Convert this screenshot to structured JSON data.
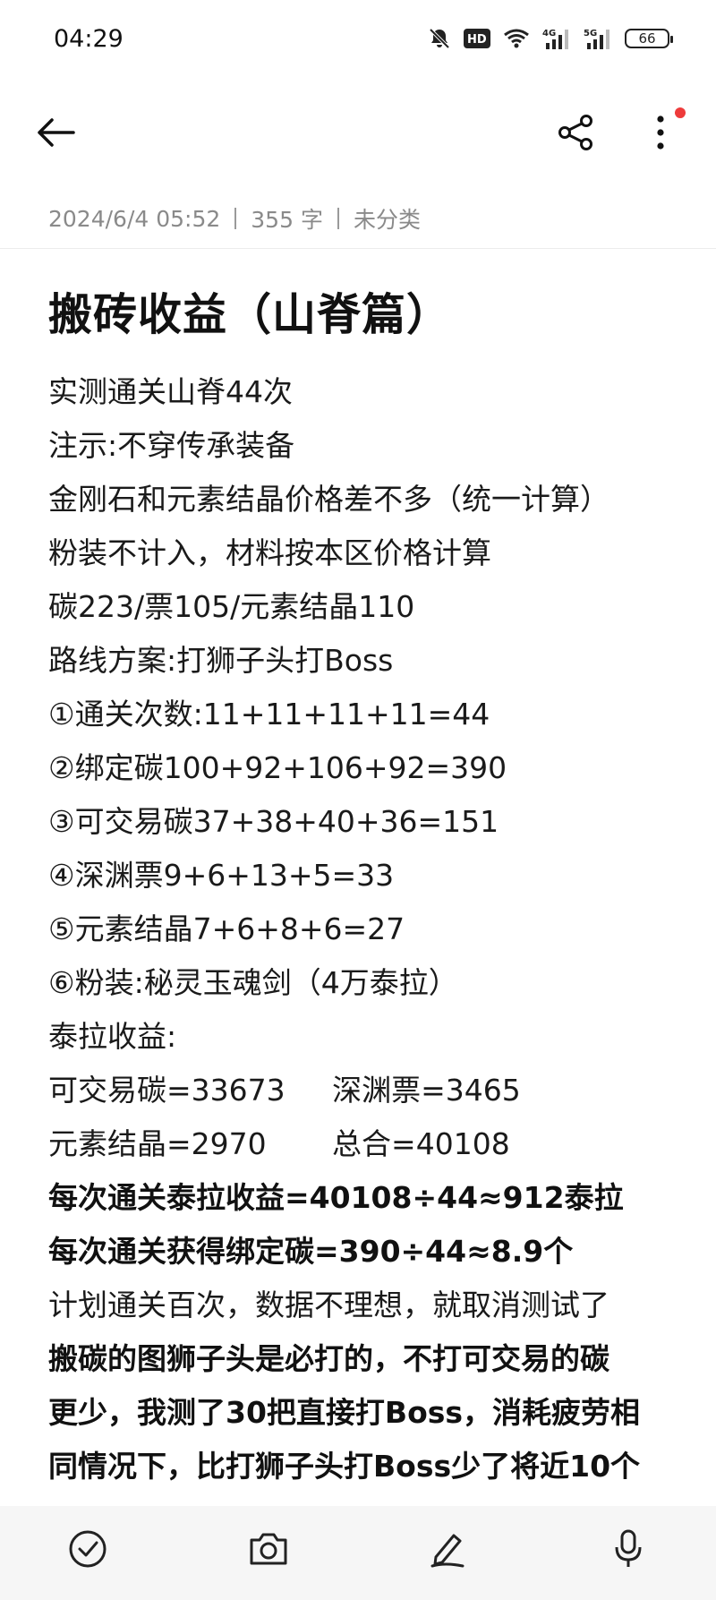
{
  "status_bar": {
    "time": "04:29",
    "battery": "66",
    "icons": [
      "mute-icon",
      "hd-icon",
      "wifi-icon",
      "signal-4g-icon",
      "signal-5g-icon",
      "battery-icon"
    ]
  },
  "toolbar": {
    "back_icon": "arrow-left-icon",
    "share_icon": "share-icon",
    "more_icon": "more-vertical-icon",
    "notification_color": "#ee3b3b"
  },
  "meta": {
    "date": "2024/6/4 05:52",
    "word_count": "355 字",
    "category": "未分类"
  },
  "note": {
    "title": "搬砖收益（山脊篇）",
    "lines": [
      {
        "text": "实测通关山脊44次"
      },
      {
        "text": "注示:不穿传承装备"
      },
      {
        "text": "金刚石和元素结晶价格差不多（统一计算）"
      },
      {
        "text": "粉装不计入，材料按本区价格计算"
      },
      {
        "text": "碳223/票105/元素结晶110"
      },
      {
        "text": "路线方案:打狮子头打Boss"
      },
      {
        "text": "①通关次数:11+11+11+11=44"
      },
      {
        "text": "②绑定碳100+92+106+92=390"
      },
      {
        "text": "③可交易碳37+38+40+36=151"
      },
      {
        "text": "④深渊票9+6+13+5=33"
      },
      {
        "text": "⑤元素结晶7+6+8+6=27"
      },
      {
        "text": "⑥粉装:秘灵玉魂剑（4万泰拉）"
      },
      {
        "text": "泰拉收益:"
      },
      {
        "text": "可交易碳=33673     深渊票=3465"
      },
      {
        "text": "元素结晶=2970       总合=40108"
      },
      {
        "text": "每次通关泰拉收益=40108÷44≈912泰拉",
        "bold": true
      },
      {
        "text": "每次通关获得绑定碳=390÷44≈8.9个",
        "bold": true
      },
      {
        "text": "计划通关百次，数据不理想，就取消测试了"
      },
      {
        "text": "搬碳的图狮子头是必打的，不打可交易的碳",
        "bold": true
      },
      {
        "text": "更少，我测了30把直接打Boss，消耗疲劳相",
        "bold": true
      },
      {
        "text": "同情况下，比打狮子头打Boss少了将近10个",
        "bold": true
      }
    ]
  },
  "bottom_bar": {
    "icons": [
      "checklist-icon",
      "camera-icon",
      "pen-icon",
      "microphone-icon"
    ]
  }
}
